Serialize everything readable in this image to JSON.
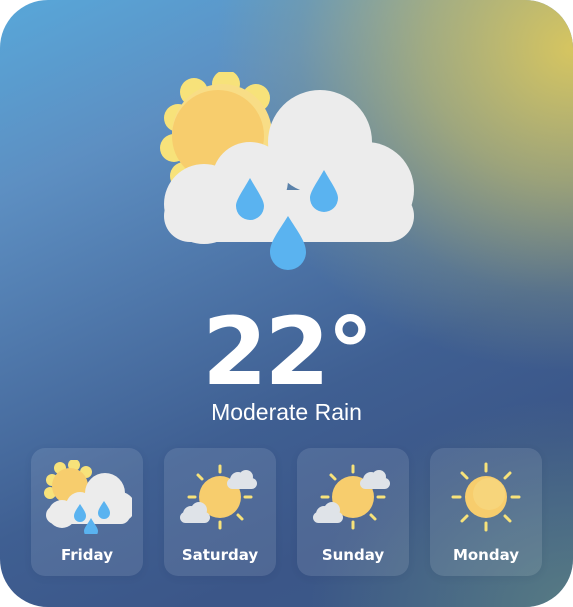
{
  "current": {
    "temperature": "22°",
    "condition": "Moderate Rain",
    "icon": "sun-cloud-rain-icon"
  },
  "forecast": [
    {
      "day": "Friday",
      "icon": "sun-cloud-rain-icon"
    },
    {
      "day": "Saturday",
      "icon": "sun-partly-cloudy-icon"
    },
    {
      "day": "Sunday",
      "icon": "sun-partly-cloudy-icon"
    },
    {
      "day": "Monday",
      "icon": "sun-icon"
    }
  ],
  "colors": {
    "sun_ray": "#f7e27a",
    "sun_core": "#f7c35a",
    "cloud": "#efefef",
    "raindrop": "#5ab3f0",
    "card_bg": "rgba(255,255,255,0.10)"
  }
}
